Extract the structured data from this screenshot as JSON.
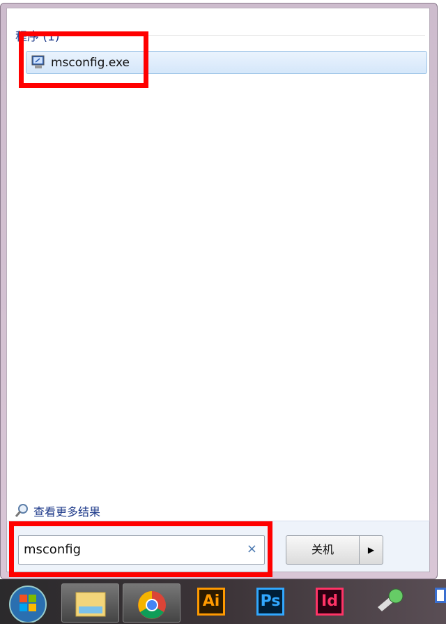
{
  "results": {
    "header": "程序 (1)",
    "items": [
      {
        "label": "msconfig.exe",
        "icon": "msconfig-icon"
      }
    ]
  },
  "see_more": "查看更多结果",
  "search": {
    "value": "msconfig",
    "clear_icon": "×"
  },
  "shutdown": {
    "label": "关机",
    "arrow": "▶"
  },
  "taskbar": {
    "apps": [
      {
        "name": "File Explorer"
      },
      {
        "name": "Chrome"
      },
      {
        "name": "Ai",
        "color": "#ff9a00"
      },
      {
        "name": "Ps",
        "color": "#31a8ff"
      },
      {
        "name": "Id",
        "color": "#ff3366"
      }
    ]
  },
  "colors": {
    "highlight": "#ff0000",
    "accent": "#1e3a8a"
  }
}
